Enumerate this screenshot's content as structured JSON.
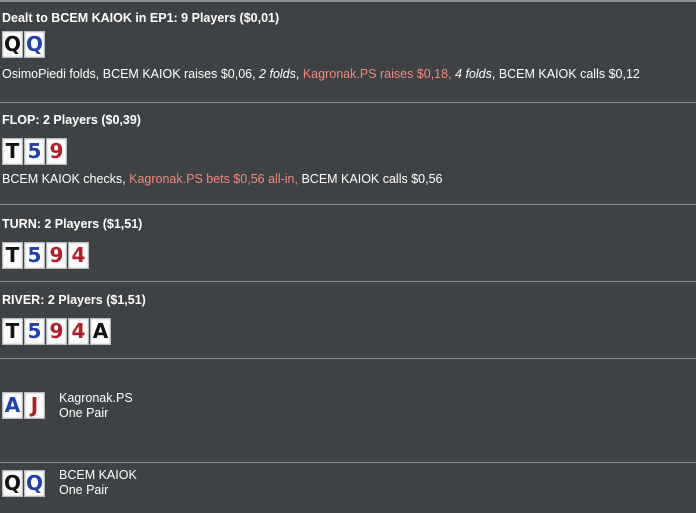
{
  "preflop": {
    "title": "Dealt to BCEM KAIOK in EP1: 9 Players ($0,01)",
    "cards": [
      {
        "rank": "Q",
        "color": "black"
      },
      {
        "rank": "Q",
        "color": "blue"
      }
    ],
    "actions": [
      {
        "text": "OsimoPiedi folds, BCEM KAIOK raises $0,06, ",
        "style": "normal"
      },
      {
        "text": "2 folds",
        "style": "italic"
      },
      {
        "text": ", ",
        "style": "normal"
      },
      {
        "text": "Kagronak.PS raises $0,18,",
        "style": "highlight"
      },
      {
        "text": " ",
        "style": "normal"
      },
      {
        "text": "4 folds",
        "style": "italic"
      },
      {
        "text": ", BCEM KAIOK calls $0,12",
        "style": "normal"
      }
    ]
  },
  "flop": {
    "title": "FLOP: 2 Players ($0,39)",
    "cards": [
      {
        "rank": "T",
        "color": "black"
      },
      {
        "rank": "5",
        "color": "blue"
      },
      {
        "rank": "9",
        "color": "red"
      }
    ],
    "actions": [
      {
        "text": "BCEM KAIOK checks, ",
        "style": "normal"
      },
      {
        "text": "Kagronak.PS bets $0,56 all-in,",
        "style": "highlight"
      },
      {
        "text": " BCEM KAIOK calls $0,56",
        "style": "normal"
      }
    ]
  },
  "turn": {
    "title": "TURN: 2 Players ($1,51)",
    "cards": [
      {
        "rank": "T",
        "color": "black"
      },
      {
        "rank": "5",
        "color": "blue"
      },
      {
        "rank": "9",
        "color": "red"
      },
      {
        "rank": "4",
        "color": "red"
      }
    ]
  },
  "river": {
    "title": "RIVER: 2 Players ($1,51)",
    "cards": [
      {
        "rank": "T",
        "color": "black"
      },
      {
        "rank": "5",
        "color": "blue"
      },
      {
        "rank": "9",
        "color": "red"
      },
      {
        "rank": "4",
        "color": "red"
      },
      {
        "rank": "A",
        "color": "black"
      }
    ]
  },
  "showdown": [
    {
      "player": "Kagronak.PS",
      "hand": "One Pair",
      "cards": [
        {
          "rank": "A",
          "color": "blue"
        },
        {
          "rank": "J",
          "color": "red"
        }
      ]
    },
    {
      "player": "BCEM KAIOK",
      "hand": "One Pair",
      "cards": [
        {
          "rank": "Q",
          "color": "black"
        },
        {
          "rank": "Q",
          "color": "blue"
        }
      ]
    }
  ],
  "colors": {
    "background": "#3f4244",
    "divider": "#8a8d8f",
    "highlight_text": "#f08a7e",
    "card_black": "#121212",
    "card_blue": "#1f3fb3",
    "card_red": "#b31d25"
  }
}
